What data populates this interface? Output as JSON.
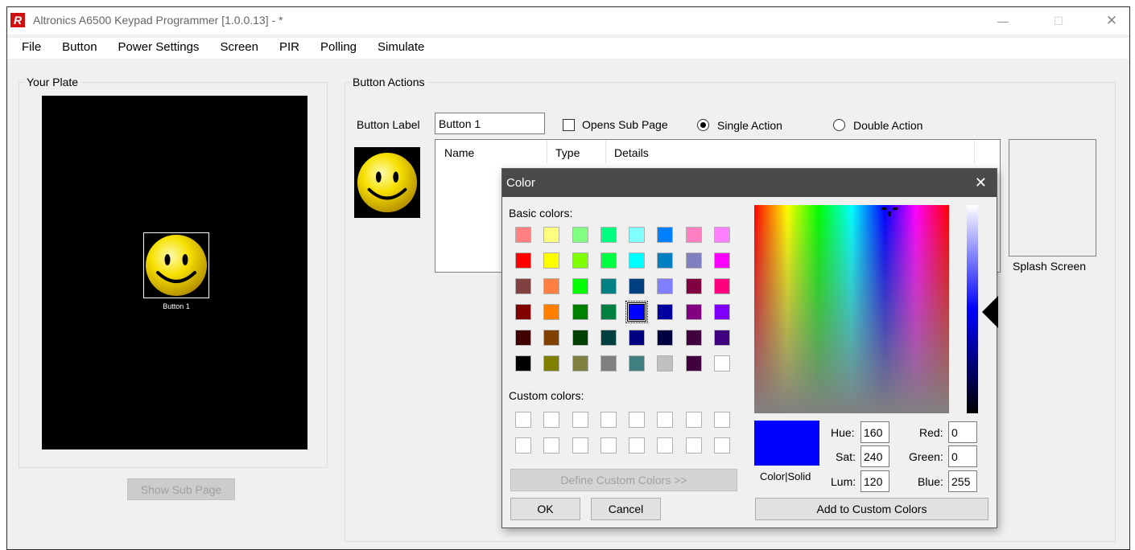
{
  "window": {
    "title": "Altronics A6500 Keypad Programmer [1.0.0.13]  - *",
    "app_icon_glyph": "R",
    "min_glyph": "—",
    "max_glyph": "☐",
    "close_glyph": "✕"
  },
  "menu": [
    "File",
    "Button",
    "Power Settings",
    "Screen",
    "PIR",
    "Polling",
    "Simulate"
  ],
  "plate": {
    "group_title": "Your Plate",
    "button_label": "Button 1",
    "show_sub_page": "Show Sub Page"
  },
  "actions": {
    "group_title": "Button Actions",
    "button_label_caption": "Button Label",
    "button_label_value": "Button 1",
    "opens_sub_page": "Opens Sub Page",
    "single_action": "Single Action",
    "double_action": "Double Action",
    "columns": [
      "Name",
      "Type",
      "Details"
    ],
    "splash_screen": "Splash Screen"
  },
  "color_dialog": {
    "title": "Color",
    "close_glyph": "✕",
    "basic_colors_label": "Basic colors:",
    "basic_colors": [
      "#ff8080",
      "#ffff80",
      "#80ff80",
      "#00ff80",
      "#80ffff",
      "#0080ff",
      "#ff80c0",
      "#ff80ff",
      "#ff0000",
      "#ffff00",
      "#80ff00",
      "#00ff40",
      "#00ffff",
      "#0080c0",
      "#8080c0",
      "#ff00ff",
      "#804040",
      "#ff8040",
      "#00ff00",
      "#008080",
      "#004080",
      "#8080ff",
      "#800040",
      "#ff0080",
      "#800000",
      "#ff8000",
      "#008000",
      "#008040",
      "#0000ff",
      "#0000a0",
      "#800080",
      "#8000ff",
      "#400000",
      "#804000",
      "#004000",
      "#004040",
      "#000080",
      "#000040",
      "#400040",
      "#400080",
      "#000000",
      "#808000",
      "#808040",
      "#808080",
      "#408080",
      "#c0c0c0",
      "#400040",
      "#ffffff"
    ],
    "selected_index": 28,
    "custom_colors_label": "Custom colors:",
    "define_custom": "Define Custom Colors >>",
    "ok": "OK",
    "cancel": "Cancel",
    "color_solid": "Color|Solid",
    "hue_label": "Hue:",
    "hue": "160",
    "sat_label": "Sat:",
    "sat": "240",
    "lum_label": "Lum:",
    "lum": "120",
    "red_label": "Red:",
    "red": "0",
    "green_label": "Green:",
    "green": "0",
    "blue_label": "Blue:",
    "blue": "255",
    "add_to_custom": "Add to Custom Colors",
    "preview_color": "#0000ff"
  }
}
